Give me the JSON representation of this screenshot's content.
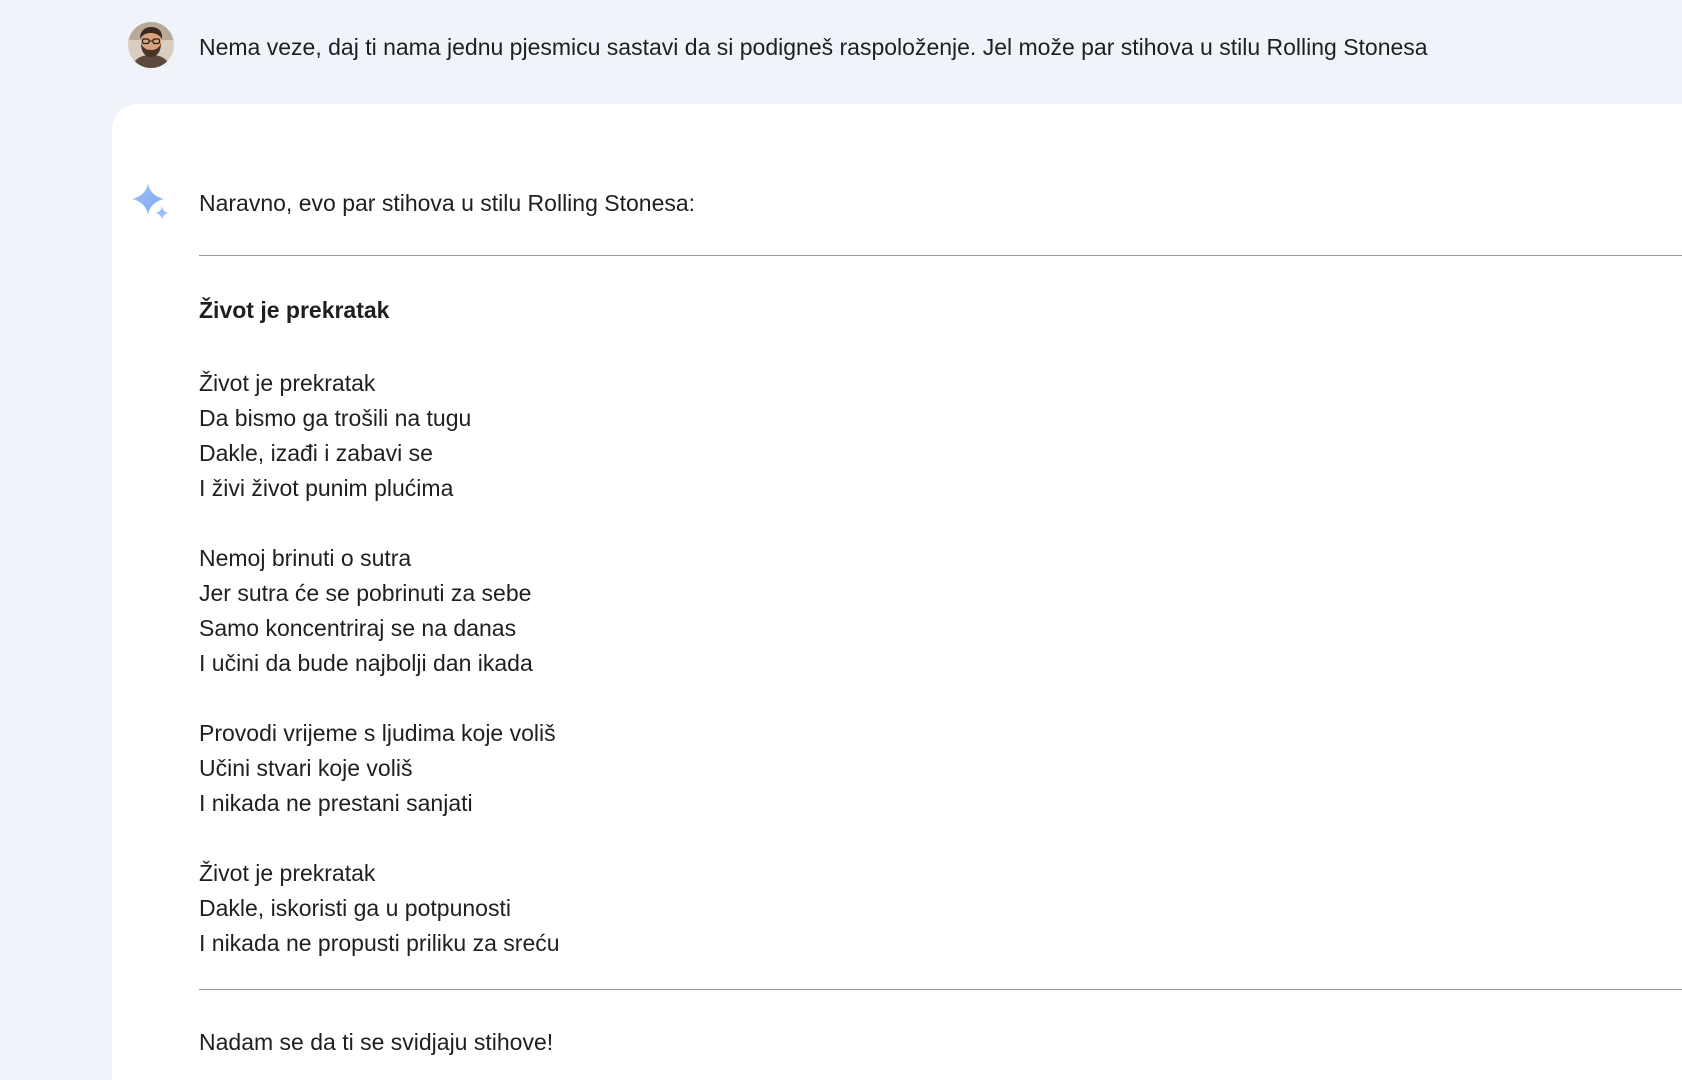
{
  "user_message": {
    "avatar_icon": "user-avatar",
    "text": "Nema veze, daj ti nama jednu pjesmicu sastavi da si podigneš raspoloženje. Jel može par stihova u stilu Rolling Stonesa"
  },
  "response": {
    "icon": "gemini-sparkle-icon",
    "accent_color": "#8ab4f8",
    "intro": "Naravno, evo par stihova u stilu Rolling Stonesa:",
    "song_title": "Život je prekratak",
    "stanzas": [
      {
        "lines": [
          "Život je prekratak",
          "Da bismo ga trošili na tugu",
          "Dakle, izađi i zabavi se",
          "I živi život punim plućima"
        ]
      },
      {
        "lines": [
          "Nemoj brinuti o sutra",
          "Jer sutra će se pobrinuti za sebe",
          "Samo koncentriraj se na danas",
          "I učini da bude najbolji dan ikada"
        ]
      },
      {
        "lines": [
          "Provodi vrijeme s ljudima koje voliš",
          "Učini stvari koje voliš",
          "I nikada ne prestani sanjati"
        ]
      },
      {
        "lines": [
          "Život je prekratak",
          "Dakle, iskoristi ga u potpunosti",
          "I nikada ne propusti priliku za sreću"
        ]
      }
    ],
    "outro": "Nadam se da ti se svidjaju stihove!"
  }
}
